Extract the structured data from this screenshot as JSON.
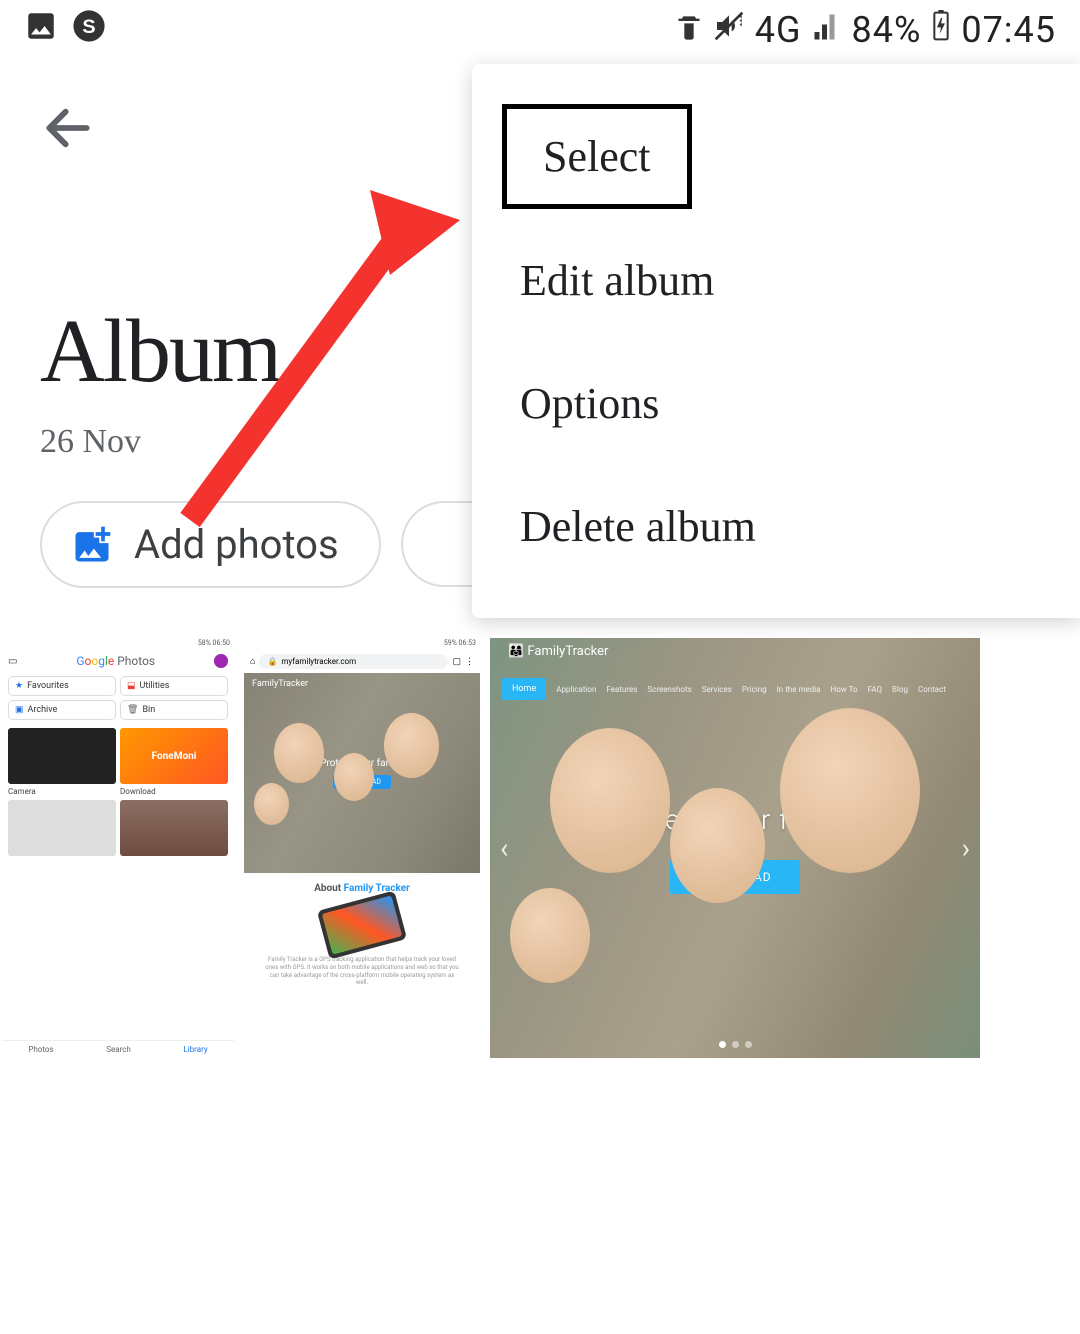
{
  "status_bar": {
    "network_label": "4G",
    "battery_percent": "84%",
    "time": "07:45"
  },
  "header": {
    "title": "Album",
    "date": "26 Nov"
  },
  "actions": {
    "add_photos": "Add photos"
  },
  "menu": {
    "items": [
      "Select",
      "Edit album",
      "Options",
      "Delete album"
    ]
  },
  "thumbs": {
    "t1": {
      "status": "58% 06:50",
      "logo": "Google Photos",
      "chips": [
        "Favourites",
        "Utilities",
        "Archive",
        "Bin"
      ],
      "albums": [
        "Camera",
        "Download"
      ],
      "fone": "FoneMoni",
      "nav": [
        "Photos",
        "Search",
        "Library"
      ]
    },
    "t2": {
      "status": "59% 06:53",
      "url": "myfamilytracker.com",
      "brand": "FamilyTracker",
      "hero_text": "Protect your family",
      "about_prefix": "About",
      "about_brand": "Family Tracker",
      "lorem": "Family Tracker is a GPS tracking application that helps track your loved ones with GPS. It works on both mobile applications and web so that you can take advantage of the cross-platform mobile operating system as well."
    },
    "t3": {
      "brand": "FamilyTracker",
      "nav": [
        "Home",
        "Application",
        "Features",
        "Screenshots",
        "Services",
        "Pricing",
        "In the media",
        "How To",
        "FAQ",
        "Blog",
        "Contact"
      ],
      "headline": "Protect your family",
      "cta": "DOWNLOAD"
    }
  }
}
